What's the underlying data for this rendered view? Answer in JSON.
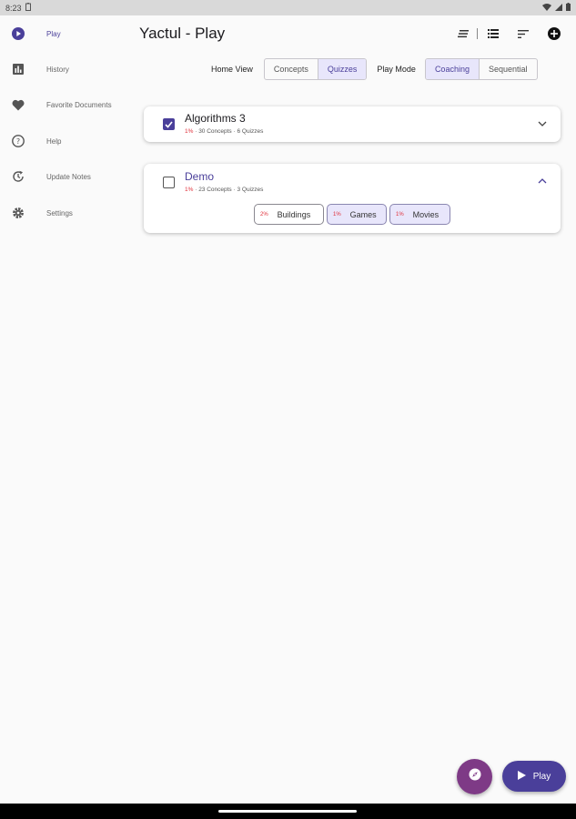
{
  "status": {
    "time": "8:23"
  },
  "app": {
    "title": "Yactul - Play"
  },
  "sidebar": {
    "items": [
      {
        "label": "Play",
        "icon": "play-circle-icon",
        "active": true
      },
      {
        "label": "History",
        "icon": "bar-chart-icon",
        "active": false
      },
      {
        "label": "Favorite Documents",
        "icon": "heart-icon",
        "active": false
      },
      {
        "label": "Help",
        "icon": "help-icon",
        "active": false
      },
      {
        "label": "Update Notes",
        "icon": "update-icon",
        "active": false
      },
      {
        "label": "Settings",
        "icon": "gear-icon",
        "active": false
      }
    ]
  },
  "toolbar": {
    "icons": [
      "notes-icon",
      "list-icon",
      "sort-icon",
      "add-icon"
    ]
  },
  "controls": {
    "home_view_label": "Home View",
    "home_view_options": [
      "Concepts",
      "Quizzes"
    ],
    "home_view_selected": "Quizzes",
    "play_mode_label": "Play Mode",
    "play_mode_options": [
      "Coaching",
      "Sequential"
    ],
    "play_mode_selected": "Coaching"
  },
  "documents": [
    {
      "title": "Algorithms 3",
      "percent": "1%",
      "meta": "· 30 Concepts · 6 Quizzes",
      "checked": true,
      "expanded": false
    },
    {
      "title": "Demo",
      "percent": "1%",
      "meta": "· 23 Concepts · 3 Quizzes",
      "checked": false,
      "expanded": true,
      "quizzes": [
        {
          "percent": "2%",
          "label": "Buildings",
          "selected": false
        },
        {
          "percent": "1%",
          "label": "Games",
          "selected": true
        },
        {
          "percent": "1%",
          "label": "Movies",
          "selected": true
        }
      ]
    }
  ],
  "fab": {
    "play_label": "Play"
  },
  "colors": {
    "accent": "#4a3f9a",
    "fab": "#7e3a86",
    "percent": "#e0303a"
  }
}
